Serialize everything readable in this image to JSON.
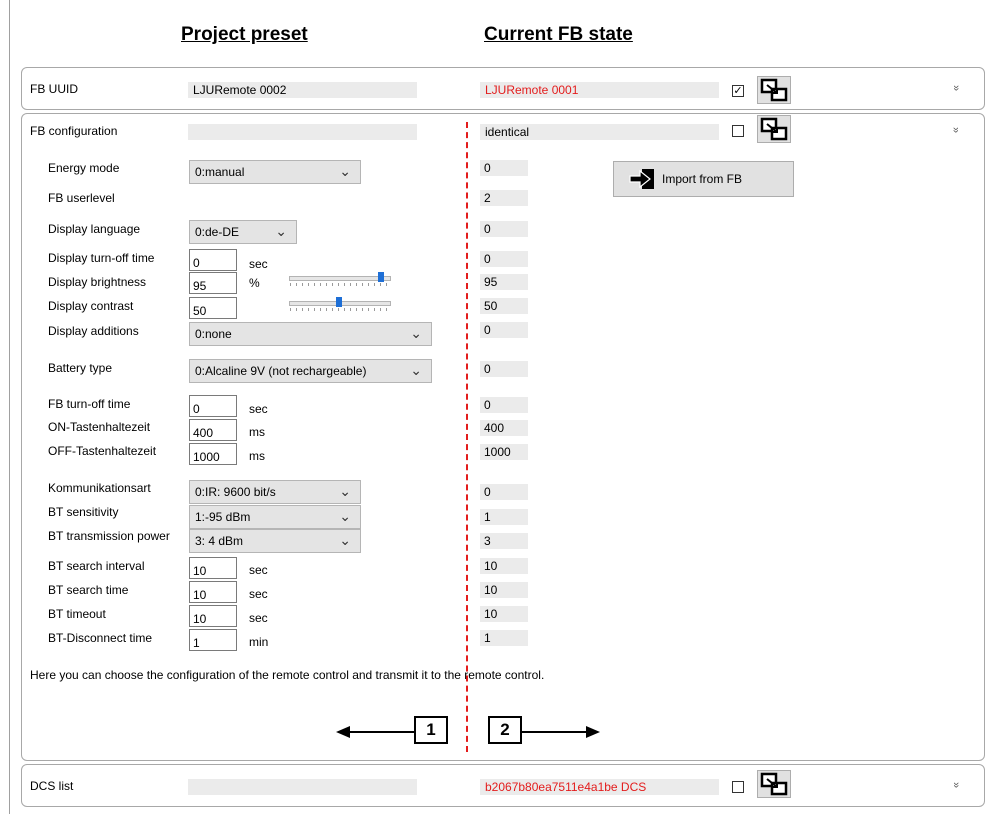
{
  "headers": {
    "project": "Project preset",
    "current": "Current FB state"
  },
  "uuid": {
    "label": "FB UUID",
    "preset": "LJURemote 0002",
    "current": "LJURemote 0001",
    "checked": true,
    "check_glyph": "✓",
    "chevron": "»"
  },
  "config": {
    "label": "FB configuration",
    "preset": "",
    "current": "identical",
    "checked": false,
    "chevron": "«",
    "import_button": "Import from FB",
    "rows": {
      "energy_mode": {
        "label": "Energy mode",
        "value": "0:manual",
        "current": "0"
      },
      "userlevel": {
        "label": "FB userlevel",
        "current": "2"
      },
      "language": {
        "label": "Display language",
        "value": "0:de-DE",
        "current": "0"
      },
      "turnoff": {
        "label": "Display turn-off time",
        "value": "0",
        "unit": "sec",
        "current": "0"
      },
      "brightness": {
        "label": "Display brightness",
        "value": "95",
        "unit": "%",
        "current": "95",
        "slider_level": 0.95
      },
      "contrast": {
        "label": "Display contrast",
        "value": "50",
        "current": "50",
        "slider_level": 0.5
      },
      "additions": {
        "label": "Display additions",
        "value": "0:none",
        "current": "0"
      },
      "battery": {
        "label": "Battery type",
        "value": "0:Alcaline 9V (not rechargeable)",
        "current": "0"
      },
      "fb_turnoff": {
        "label": "FB turn-off time",
        "value": "0",
        "unit": "sec",
        "current": "0"
      },
      "on_hold": {
        "label": "ON-Tastenhaltezeit",
        "value": "400",
        "unit": "ms",
        "current": "400"
      },
      "off_hold": {
        "label": "OFF-Tastenhaltezeit",
        "value": "1000",
        "unit": "ms",
        "current": "1000"
      },
      "komm": {
        "label": "Kommunikationsart",
        "value": "0:IR: 9600 bit/s",
        "current": "0"
      },
      "bt_sens": {
        "label": "BT sensitivity",
        "value": "1:-95 dBm",
        "current": "1"
      },
      "bt_power": {
        "label": "BT transmission power",
        "value": "3: 4 dBm",
        "current": "3"
      },
      "bt_interval": {
        "label": "BT search interval",
        "value": "10",
        "unit": "sec",
        "current": "10"
      },
      "bt_time": {
        "label": "BT search time",
        "value": "10",
        "unit": "sec",
        "current": "10"
      },
      "bt_timeout": {
        "label": "BT timeout",
        "value": "10",
        "unit": "sec",
        "current": "10"
      },
      "bt_disc": {
        "label": "BT-Disconnect time",
        "value": "1",
        "unit": "min",
        "current": "1"
      }
    },
    "help_text": "Here you can choose the configuration of the remote control and transmit it to the remote control.",
    "marker_left": "1",
    "marker_right": "2"
  },
  "dcs": {
    "label": "DCS list",
    "preset": "",
    "current": "b2067b80ea7511e4a1be DCS",
    "checked": false,
    "chevron": "»"
  },
  "colors": {
    "changed_text": "#e31c1c",
    "separator": "#e31c1c",
    "slider_thumb": "#1e6fd6"
  },
  "icons": {
    "transfer": "transfer-icon",
    "import": "import-arrow-icon",
    "chevron_down": "double-chevron-down-icon",
    "chevron_up": "double-chevron-up-icon"
  }
}
